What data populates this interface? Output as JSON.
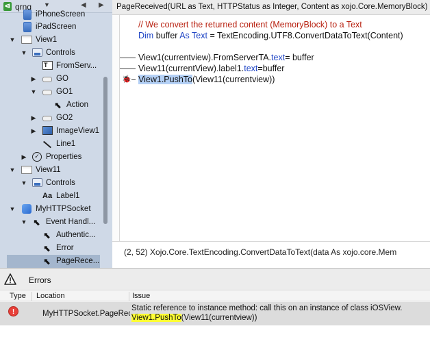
{
  "navigator": {
    "project_name": "qrng",
    "items": [
      {
        "label": "iPhoneScreen",
        "icon": "device-icon"
      },
      {
        "label": "iPadScreen",
        "icon": "device-icon"
      },
      {
        "label": "View1",
        "icon": "window-icon"
      },
      {
        "label": "Controls",
        "icon": "controls-icon"
      },
      {
        "label": "FromServ...",
        "icon": "textarea-icon"
      },
      {
        "label": "GO",
        "icon": "button-icon"
      },
      {
        "label": "GO1",
        "icon": "button-icon"
      },
      {
        "label": "Action",
        "icon": "cursor-icon"
      },
      {
        "label": "GO2",
        "icon": "button-icon"
      },
      {
        "label": "ImageView1",
        "icon": "imageview-icon"
      },
      {
        "label": "Line1",
        "icon": "line-icon"
      },
      {
        "label": "Properties",
        "icon": "checkmark-icon"
      },
      {
        "label": "View11",
        "icon": "window-icon"
      },
      {
        "label": "Controls",
        "icon": "controls-icon"
      },
      {
        "label": "Label1",
        "icon": "label-icon",
        "icon_text": "Aa"
      },
      {
        "label": "MyHTTPSocket",
        "icon": "socket-icon"
      },
      {
        "label": "Event Handl...",
        "icon": "cursor-icon"
      },
      {
        "label": "Authentic...",
        "icon": "cursor-icon"
      },
      {
        "label": "Error",
        "icon": "cursor-icon"
      },
      {
        "label": "PageRece...",
        "icon": "cursor-icon",
        "selected": true
      }
    ]
  },
  "editor": {
    "signature": "PageReceived(URL as Text, HTTPStatus as Integer, Content as xojo.Core.MemoryBlock)",
    "lines": {
      "l1_comment": "// We convert the returned content (MemoryBlock) to a Text",
      "l2_kw_dim": "Dim",
      "l2_a": " buffer ",
      "l2_kw_as": "As",
      "l2_kw_text": " Text",
      "l2_b": " = TextEncoding.UTF8.ConvertDataToText(Content)",
      "l3_a": "View1(currentview).FromServerTA.",
      "l3_kw": "text",
      "l3_b": "= buffer",
      "l4_a": "View11(currentView).label1.",
      "l4_kw": "text",
      "l4_b": "=buffer",
      "l5_hl": "View1.PushTo",
      "l5_b": "(View11(currentview))"
    },
    "status_text": "(2, 52) Xojo.Core.TextEncoding.ConvertDataToText(data As xojo.core.Mem"
  },
  "errors": {
    "title": "Errors",
    "columns": {
      "type": "Type",
      "location": "Location",
      "issue": "Issue"
    },
    "rows": [
      {
        "location": "MyHTTPSocket.PageRece",
        "message": "Static reference to instance method: call this on an instance of class iOSView.",
        "code_highlight": "View1.PushTo",
        "code_rest": "(View11(currentview))"
      }
    ]
  },
  "colors": {
    "navigator_bg": "#cfd9e7",
    "selected_row": "#a4b6cd",
    "comment": "#b8200f",
    "keyword": "#1d43c4",
    "selection": "#b4d0f5",
    "error_highlight": "#ffff33",
    "error_icon": "#e8413a"
  }
}
